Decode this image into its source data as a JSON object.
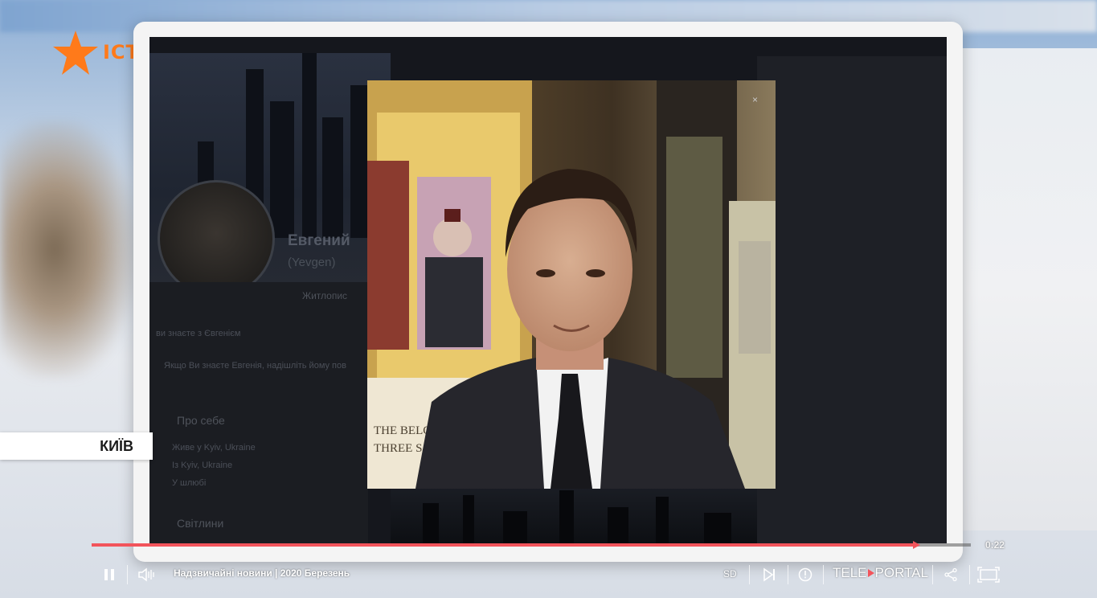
{
  "channel": {
    "logo_text": "ICTV",
    "logo_color": "#ff7a1a"
  },
  "location_tag": "КИЇВ",
  "background_profile": {
    "name": "Евгений",
    "latin_name": "(Yevgen)",
    "tab_label": "Житлопис",
    "section_known": "ви знаєте з Євгенієм",
    "invite_text": "Якщо Ви знаєте Евгенія, надішліть йому пов",
    "about_title": "Про себе",
    "about_items": [
      "Живе у Kyiv, Ukraine",
      "Із Kyiv, Ukraine",
      "У шлюбі"
    ],
    "photos_title": "Світлини"
  },
  "photo": {
    "close_glyph": "×"
  },
  "player": {
    "progress_fraction": 0.94,
    "time": "0:22",
    "title": "Надзвичайні новини | 2020 Березень",
    "quality": "SD",
    "brand_left": "TELE",
    "brand_right": "PORTAL",
    "accent_color": "#f2545b",
    "icons": [
      "pause-icon",
      "volume-icon",
      "next-icon",
      "info-icon",
      "share-icon",
      "fullscreen-icon"
    ]
  }
}
